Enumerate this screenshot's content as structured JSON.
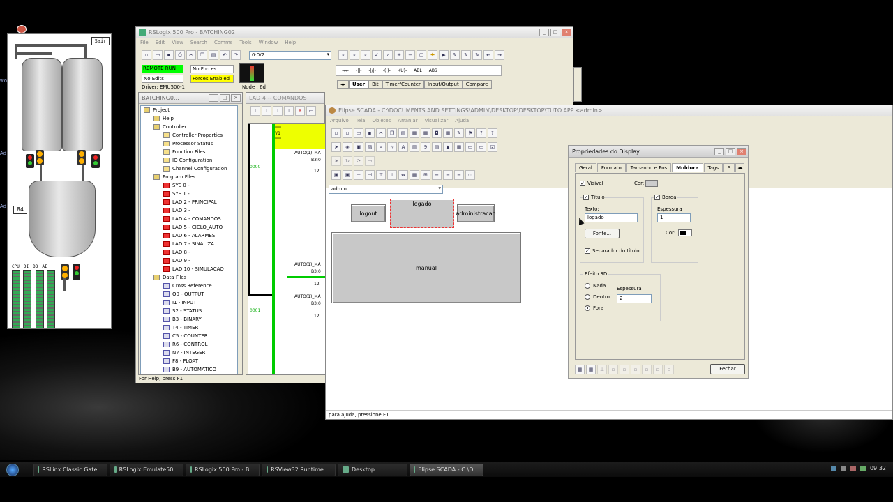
{
  "desktop": {
    "left_icons": [
      "wor",
      "Ad",
      "Ad"
    ]
  },
  "scada_panel": {
    "exit_label": "Sair",
    "value_display": "84",
    "module_labels": [
      "CPU",
      "DI",
      "DO",
      "AI"
    ]
  },
  "rslogix": {
    "title": "RSLogix 500 Pro - BATCHING02",
    "menu": [
      "File",
      "Edit",
      "View",
      "Search",
      "Comms",
      "Tools",
      "Window",
      "Help"
    ],
    "address_field": "0:0/2",
    "mode": "REMOTE RUN",
    "forces": "No Forces",
    "edits": "No Edits",
    "forces_enabled": "Forces Enabled",
    "driver": "Driver: EMU500-1",
    "node": "Node : 6d",
    "instr_tabs": [
      "User",
      "Bit",
      "Timer/Counter",
      "Input/Output",
      "Compare"
    ],
    "instr_symbols": [
      "→←",
      "-||-",
      "-|/|-",
      "-( )-",
      "-(U)-",
      "ABL",
      "ABS"
    ],
    "status": "For Help, press F1"
  },
  "project_tree": {
    "title": "BATCHING0...",
    "items": [
      {
        "label": "Project",
        "level": 0,
        "icon": "folder"
      },
      {
        "label": "Help",
        "level": 1,
        "icon": "folder"
      },
      {
        "label": "Controller",
        "level": 1,
        "icon": "folder"
      },
      {
        "label": "Controller Properties",
        "level": 2,
        "icon": "info"
      },
      {
        "label": "Processor Status",
        "level": 2,
        "icon": "doc"
      },
      {
        "label": "Function Files",
        "level": 2,
        "icon": "doc"
      },
      {
        "label": "IO Configuration",
        "level": 2,
        "icon": "doc"
      },
      {
        "label": "Channel Configuration",
        "level": 2,
        "icon": "doc"
      },
      {
        "label": "Program Files",
        "level": 1,
        "icon": "folder"
      },
      {
        "label": "SYS 0 -",
        "level": 2,
        "icon": "ladder"
      },
      {
        "label": "SYS 1 -",
        "level": 2,
        "icon": "ladder"
      },
      {
        "label": "LAD 2 - PRINCIPAL",
        "level": 2,
        "icon": "ladder"
      },
      {
        "label": "LAD 3 -",
        "level": 2,
        "icon": "ladder"
      },
      {
        "label": "LAD 4 - COMANDOS",
        "level": 2,
        "icon": "ladder"
      },
      {
        "label": "LAD 5 - CICLO_AUTO",
        "level": 2,
        "icon": "ladder"
      },
      {
        "label": "LAD 6 - ALARMES",
        "level": 2,
        "icon": "ladder"
      },
      {
        "label": "LAD 7 - SINALIZA",
        "level": 2,
        "icon": "ladder"
      },
      {
        "label": "LAD 8 -",
        "level": 2,
        "icon": "ladder"
      },
      {
        "label": "LAD 9 -",
        "level": 2,
        "icon": "ladder"
      },
      {
        "label": "LAD 10 - SIMULACAO",
        "level": 2,
        "icon": "ladder"
      },
      {
        "label": "Data Files",
        "level": 1,
        "icon": "folder"
      },
      {
        "label": "Cross Reference",
        "level": 2,
        "icon": "data"
      },
      {
        "label": "O0 - OUTPUT",
        "level": 2,
        "icon": "data"
      },
      {
        "label": "I1 - INPUT",
        "level": 2,
        "icon": "data"
      },
      {
        "label": "S2 - STATUS",
        "level": 2,
        "icon": "data"
      },
      {
        "label": "B3 - BINARY",
        "level": 2,
        "icon": "data"
      },
      {
        "label": "T4 - TIMER",
        "level": 2,
        "icon": "data"
      },
      {
        "label": "C5 - COUNTER",
        "level": 2,
        "icon": "data"
      },
      {
        "label": "R6 - CONTROL",
        "level": 2,
        "icon": "data"
      },
      {
        "label": "N7 - INTEGER",
        "level": 2,
        "icon": "data"
      },
      {
        "label": "F8 - FLOAT",
        "level": 2,
        "icon": "data"
      },
      {
        "label": "B9 - AUTOMATICO",
        "level": 2,
        "icon": "data"
      }
    ]
  },
  "ladder": {
    "title": "LAD 4 -- COMANDOS",
    "rung_numbers": [
      "0000",
      "0001"
    ],
    "comment_lines": [
      "***",
      "V1",
      "***"
    ],
    "instructions": [
      {
        "tag": "AUTO(1)_MA",
        "addr": "B3:0",
        "bit": "12"
      },
      {
        "tag": "AUTO(1)_MA",
        "addr": "B3:0",
        "bit": "12"
      },
      {
        "tag": "AUTO(1)_MA",
        "addr": "B3:0",
        "bit": "12"
      }
    ]
  },
  "elipse": {
    "title": "Elipse SCADA - C:\\DOCUMENTS AND SETTINGS\\ADMIN\\DESKTOP\\DESKTOP\\TUTO.APP <admin>",
    "menu": [
      "Arquivo",
      "Tela",
      "Objetos",
      "Arranjar",
      "Visualizar",
      "Ajuda"
    ],
    "screen_select": "admin",
    "buttons": {
      "logout": "logout",
      "logado": "logado",
      "administracao": "administracao",
      "manual": "manual"
    },
    "status": "para ajuda, pressione F1"
  },
  "dialog": {
    "title": "Propriedades do Display",
    "tabs": [
      "Geral",
      "Formato",
      "Tamanho e Pos",
      "Moldura",
      "Tags",
      "S"
    ],
    "active_tab": "Moldura",
    "visivel": "Visível",
    "cor": "Cor:",
    "titulo": "Título",
    "texto_label": "Texto:",
    "texto_value": "logado",
    "fonte_button": "Fonte...",
    "separador": "Separador do título",
    "borda": "Borda",
    "espessura_label": "Espessura",
    "espessura_borda": "1",
    "cor_borda": "Cor:",
    "efeito3d": "Efeito 3D",
    "radios": [
      "Nada",
      "Dentro",
      "Fora"
    ],
    "selected_radio": "Fora",
    "espessura_3d_label": "Espessura",
    "espessura_3d": "2",
    "fechar": "Fechar"
  },
  "taskbar": {
    "tasks": [
      {
        "label": "RSLinx Classic Gate...",
        "active": false
      },
      {
        "label": "RSLogix Emulate50...",
        "active": false
      },
      {
        "label": "RSLogix 500 Pro - B...",
        "active": false
      },
      {
        "label": "RSView32 Runtime ...",
        "active": false
      },
      {
        "label": "Desktop",
        "active": false
      },
      {
        "label": "Elipse SCADA - C:\\D...",
        "active": true
      }
    ],
    "clock": "09:32"
  }
}
